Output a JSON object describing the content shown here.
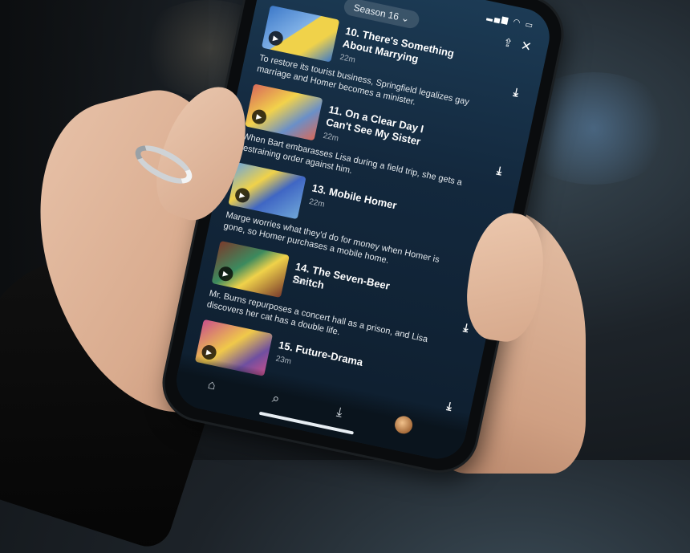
{
  "header": {
    "season_label": "Season 16 ⌄",
    "share_icon": "share-icon",
    "close_icon": "close-icon",
    "status_icons": "▂▄▆ ◠ ▭"
  },
  "episodes": [
    {
      "title": "10. There's Something About Marrying",
      "duration": "22m",
      "description": "To restore its tourist business, Springfield legalizes gay marriage and Homer becomes a minister.",
      "thumb_colors": [
        "#3d79c9",
        "#f0d24a"
      ]
    },
    {
      "title": "11. On a Clear Day I Can't See My Sister",
      "duration": "22m",
      "description": "When Bart embarasses Lisa during a field trip, she gets a restraining order against him.",
      "thumb_colors": [
        "#d96a5a",
        "#f2d24b"
      ]
    },
    {
      "title": "13. Mobile Homer",
      "duration": "22m",
      "description": "Marge worries what they'd do for money when Homer is gone, so Homer purchases a mobile home.",
      "thumb_colors": [
        "#6fa6d8",
        "#3f66c4"
      ]
    },
    {
      "title": "14. The Seven-Beer Snitch",
      "duration": "22m",
      "description": "Mr. Burns repurposes a concert hall as a prison, and Lisa discovers her cat has a double life.",
      "thumb_colors": [
        "#7a3b2c",
        "#3c8a5e"
      ]
    },
    {
      "title": "15. Future-Drama",
      "duration": "23m",
      "description": "",
      "thumb_colors": [
        "#c94f8a",
        "#f0c94a"
      ]
    }
  ],
  "tabbar": {
    "home_icon": "home-icon",
    "search_icon": "search-icon",
    "downloads_icon": "download-icon",
    "avatar": "profile-avatar"
  },
  "colors": {
    "screen_bg": "#13283d",
    "accent_text": "#ffffff"
  }
}
